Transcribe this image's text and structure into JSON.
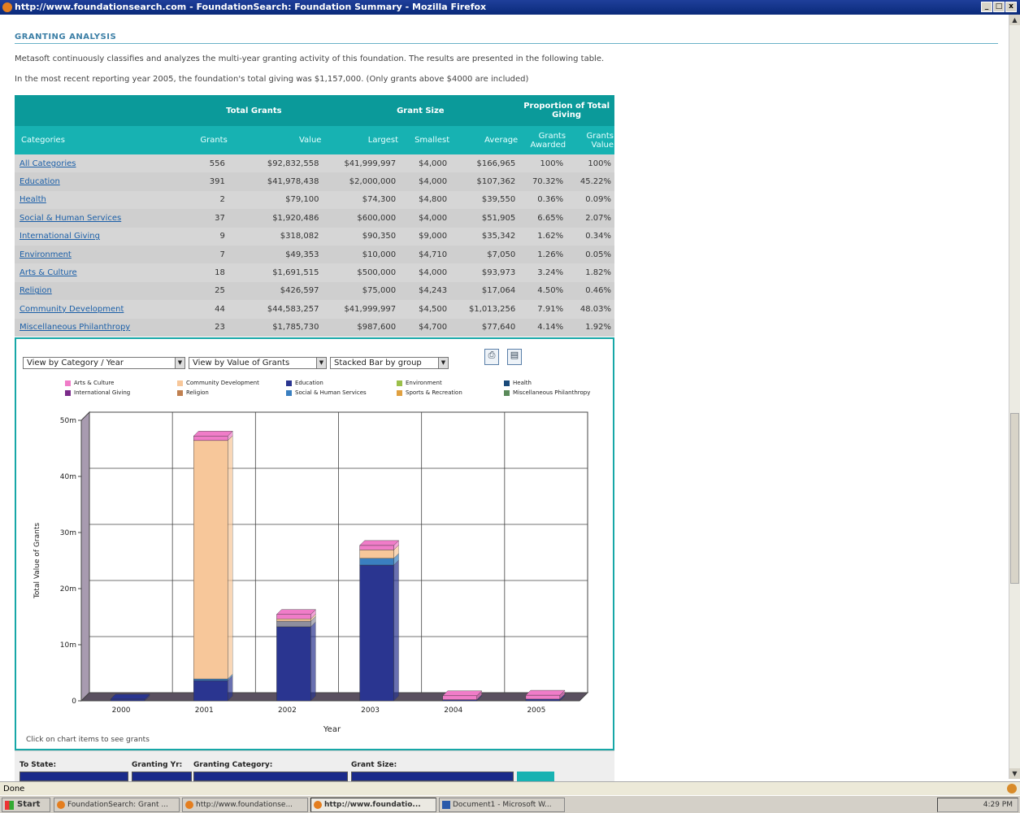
{
  "window": {
    "title": "http://www.foundationsearch.com - FoundationSearch: Foundation Summary - Mozilla Firefox",
    "controls": [
      "_",
      "□",
      "x"
    ]
  },
  "section": {
    "title": "GRANTING ANALYSIS",
    "intro1": "Metasoft continuously classifies and analyzes the multi-year granting activity of this foundation. The results are presented in the following table.",
    "intro2": "In the most recent reporting year 2005, the foundation's total giving was $1,157,000. (Only grants above $4000 are included)"
  },
  "table": {
    "group_headers": {
      "total": "Total Grants",
      "size": "Grant Size",
      "proportion": "Proportion of Total Giving"
    },
    "columns": {
      "category": "Categories",
      "grants": "Grants",
      "value": "Value",
      "largest": "Largest",
      "smallest": "Smallest",
      "average": "Average",
      "awarded": "Grants Awarded",
      "gvalue": "Grants Value"
    },
    "rows": [
      [
        "All Categories",
        "556",
        "$92,832,558",
        "$41,999,997",
        "$4,000",
        "$166,965",
        "100%",
        "100%"
      ],
      [
        "Education",
        "391",
        "$41,978,438",
        "$2,000,000",
        "$4,000",
        "$107,362",
        "70.32%",
        "45.22%"
      ],
      [
        "Health",
        "2",
        "$79,100",
        "$74,300",
        "$4,800",
        "$39,550",
        "0.36%",
        "0.09%"
      ],
      [
        "Social & Human Services",
        "37",
        "$1,920,486",
        "$600,000",
        "$4,000",
        "$51,905",
        "6.65%",
        "2.07%"
      ],
      [
        "International Giving",
        "9",
        "$318,082",
        "$90,350",
        "$9,000",
        "$35,342",
        "1.62%",
        "0.34%"
      ],
      [
        "Environment",
        "7",
        "$49,353",
        "$10,000",
        "$4,710",
        "$7,050",
        "1.26%",
        "0.05%"
      ],
      [
        "Arts & Culture",
        "18",
        "$1,691,515",
        "$500,000",
        "$4,000",
        "$93,973",
        "3.24%",
        "1.82%"
      ],
      [
        "Religion",
        "25",
        "$426,597",
        "$75,000",
        "$4,243",
        "$17,064",
        "4.50%",
        "0.46%"
      ],
      [
        "Community Development",
        "44",
        "$44,583,257",
        "$41,999,997",
        "$4,500",
        "$1,013,256",
        "7.91%",
        "48.03%"
      ],
      [
        "Miscellaneous Philanthropy",
        "23",
        "$1,785,730",
        "$987,600",
        "$4,700",
        "$77,640",
        "4.14%",
        "1.92%"
      ]
    ]
  },
  "controls": {
    "view1": "View by Category / Year",
    "view2": "View by Value of Grants",
    "view3": "Stacked Bar by group",
    "click_note": "Click on chart items to see grants"
  },
  "chart_data": {
    "type": "bar",
    "stacked": true,
    "categories": [
      "2000",
      "2001",
      "2002",
      "2003",
      "2004",
      "2005"
    ],
    "xlabel": "Year",
    "ylabel": "Total Value of Grants",
    "ylim": [
      0,
      50000000
    ],
    "yticks": [
      "0",
      "10m",
      "20m",
      "30m",
      "40m",
      "50m"
    ],
    "series": [
      {
        "name": "Education",
        "color": "#2a3590",
        "values": [
          300000,
          3600000,
          13200000,
          24200000,
          200000,
          300000
        ]
      },
      {
        "name": "Social & Human Services",
        "color": "#3a7fc0",
        "values": [
          0,
          300000,
          0,
          1200000,
          0,
          0
        ]
      },
      {
        "name": "Environment",
        "color": "#8e8e9e",
        "values": [
          0,
          0,
          1000000,
          0,
          0,
          0
        ]
      },
      {
        "name": "Community Development",
        "color": "#f7c79a",
        "values": [
          0,
          42500000,
          400000,
          1500000,
          0,
          0
        ]
      },
      {
        "name": "Arts & Culture",
        "color": "#f07cc8",
        "values": [
          0,
          800000,
          800000,
          800000,
          700000,
          700000
        ]
      }
    ],
    "legend": [
      {
        "name": "Arts & Culture",
        "color": "#f07cc8"
      },
      {
        "name": "Community Development",
        "color": "#f7c79a"
      },
      {
        "name": "Education",
        "color": "#2a3590"
      },
      {
        "name": "Environment",
        "color": "#9bbf4a"
      },
      {
        "name": "Health",
        "color": "#1a4a7a"
      },
      {
        "name": "International Giving",
        "color": "#7a2a8a"
      },
      {
        "name": "Religion",
        "color": "#c08050"
      },
      {
        "name": "Social & Human Services",
        "color": "#3a7fc0"
      },
      {
        "name": "Sports & Recreation",
        "color": "#e0a040"
      },
      {
        "name": "Miscellaneous Philanthropy",
        "color": "#5a8a5a"
      }
    ]
  },
  "filters": {
    "to_state": "To State:",
    "granting_yr": "Granting Yr:",
    "granting_category": "Granting Category:",
    "grant_size": "Grant Size:"
  },
  "status": {
    "text": "Done"
  },
  "taskbar": {
    "start": "Start",
    "items": [
      "FoundationSearch: Grant ...",
      "http://www.foundationse...",
      "http://www.foundatio...",
      "Document1 - Microsoft W..."
    ],
    "clock": "4:29 PM"
  }
}
